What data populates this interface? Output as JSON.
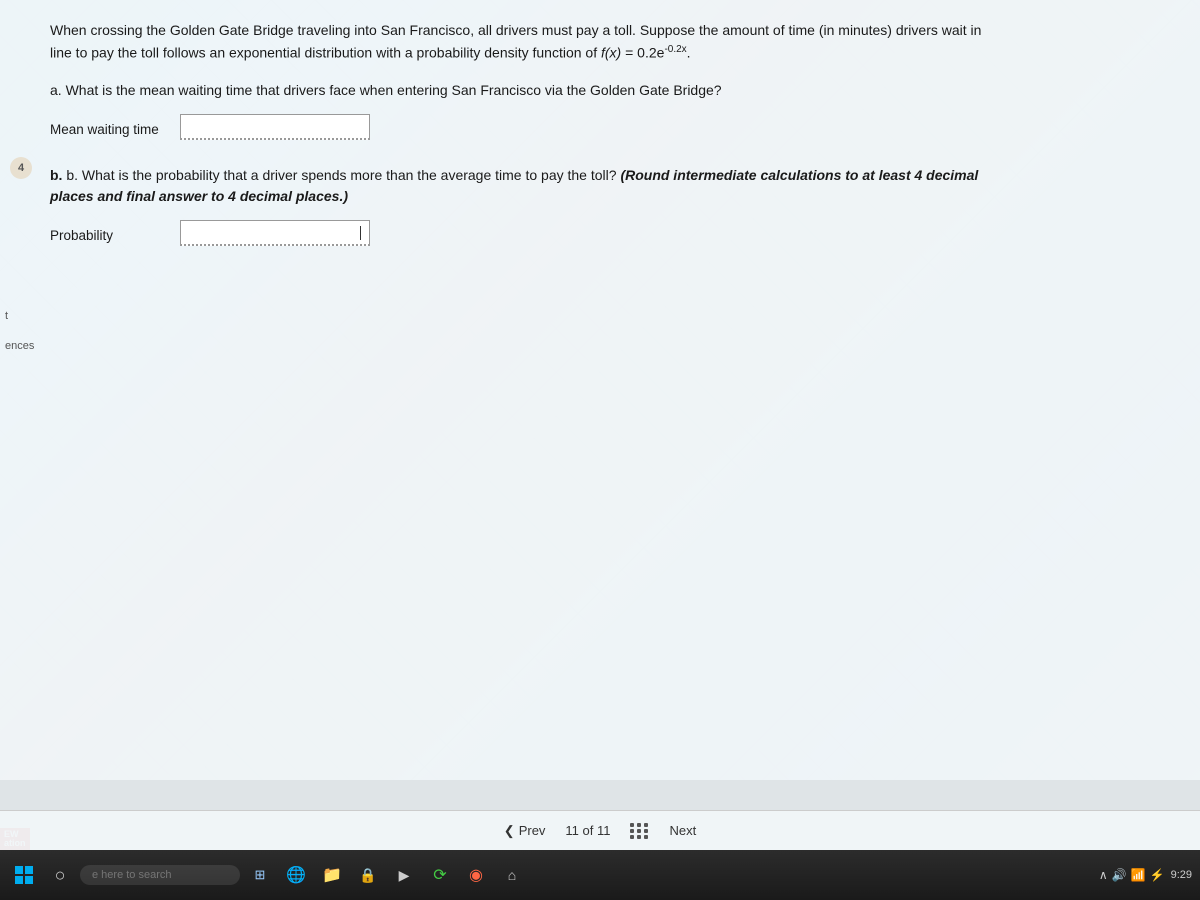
{
  "screen": {
    "question_intro": "When crossing the Golden Gate Bridge traveling into San Francisco, all drivers must pay a toll. Suppose the amount of time (in minutes) drivers wait in line to pay the toll follows an exponential distribution with a probability density function of",
    "formula_text": "f(x)",
    "formula_equals": "= 0.2e",
    "formula_exponent": "-0.2x",
    "question_a": "a. What is the mean waiting time that drivers face when entering San Francisco via the Golden Gate Bridge?",
    "label_mean": "Mean waiting time",
    "question_b_start": "b. What is the probability that a driver spends more than the average time to pay the toll?",
    "question_b_bold": "(Round intermediate calculations to at least 4 decimal places and final answer to 4 decimal places.)",
    "label_probability": "Probability",
    "margin_number": "4",
    "left_label_t": "t",
    "left_label_ences": "ences",
    "left_label_ew": "EW",
    "left_label_ation": "ation"
  },
  "pagination": {
    "prev_label": "Prev",
    "page_info": "11 of 11",
    "next_label": "Next"
  },
  "taskbar": {
    "search_placeholder": "e here to search",
    "time": "9:29"
  }
}
